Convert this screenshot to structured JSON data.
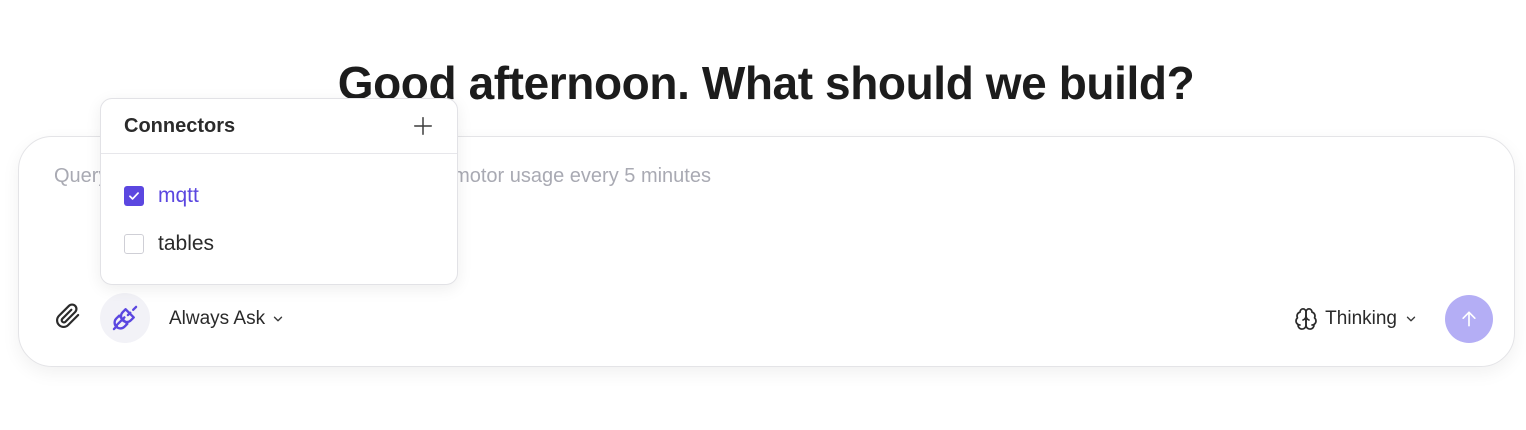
{
  "heading": "Good afternoon. What should we build?",
  "composer": {
    "placeholder": "Query mqtt and tables and summarize line-3 motor usage every 5 minutes",
    "mode_label": "Always Ask",
    "model_label": "Thinking",
    "icons": {
      "attach": "paperclip-icon",
      "connectors": "plug-icon",
      "mode_chevron": "chevron-down-icon",
      "model": "brain-icon",
      "send": "arrow-up-icon"
    }
  },
  "connectors_popover": {
    "title": "Connectors",
    "add_icon": "plus-icon",
    "items": [
      {
        "label": "mqtt",
        "checked": true
      },
      {
        "label": "tables",
        "checked": false
      }
    ]
  },
  "colors": {
    "accent": "#5b47e0",
    "send_button": "#b4aef5",
    "placeholder": "#a9aab3"
  }
}
